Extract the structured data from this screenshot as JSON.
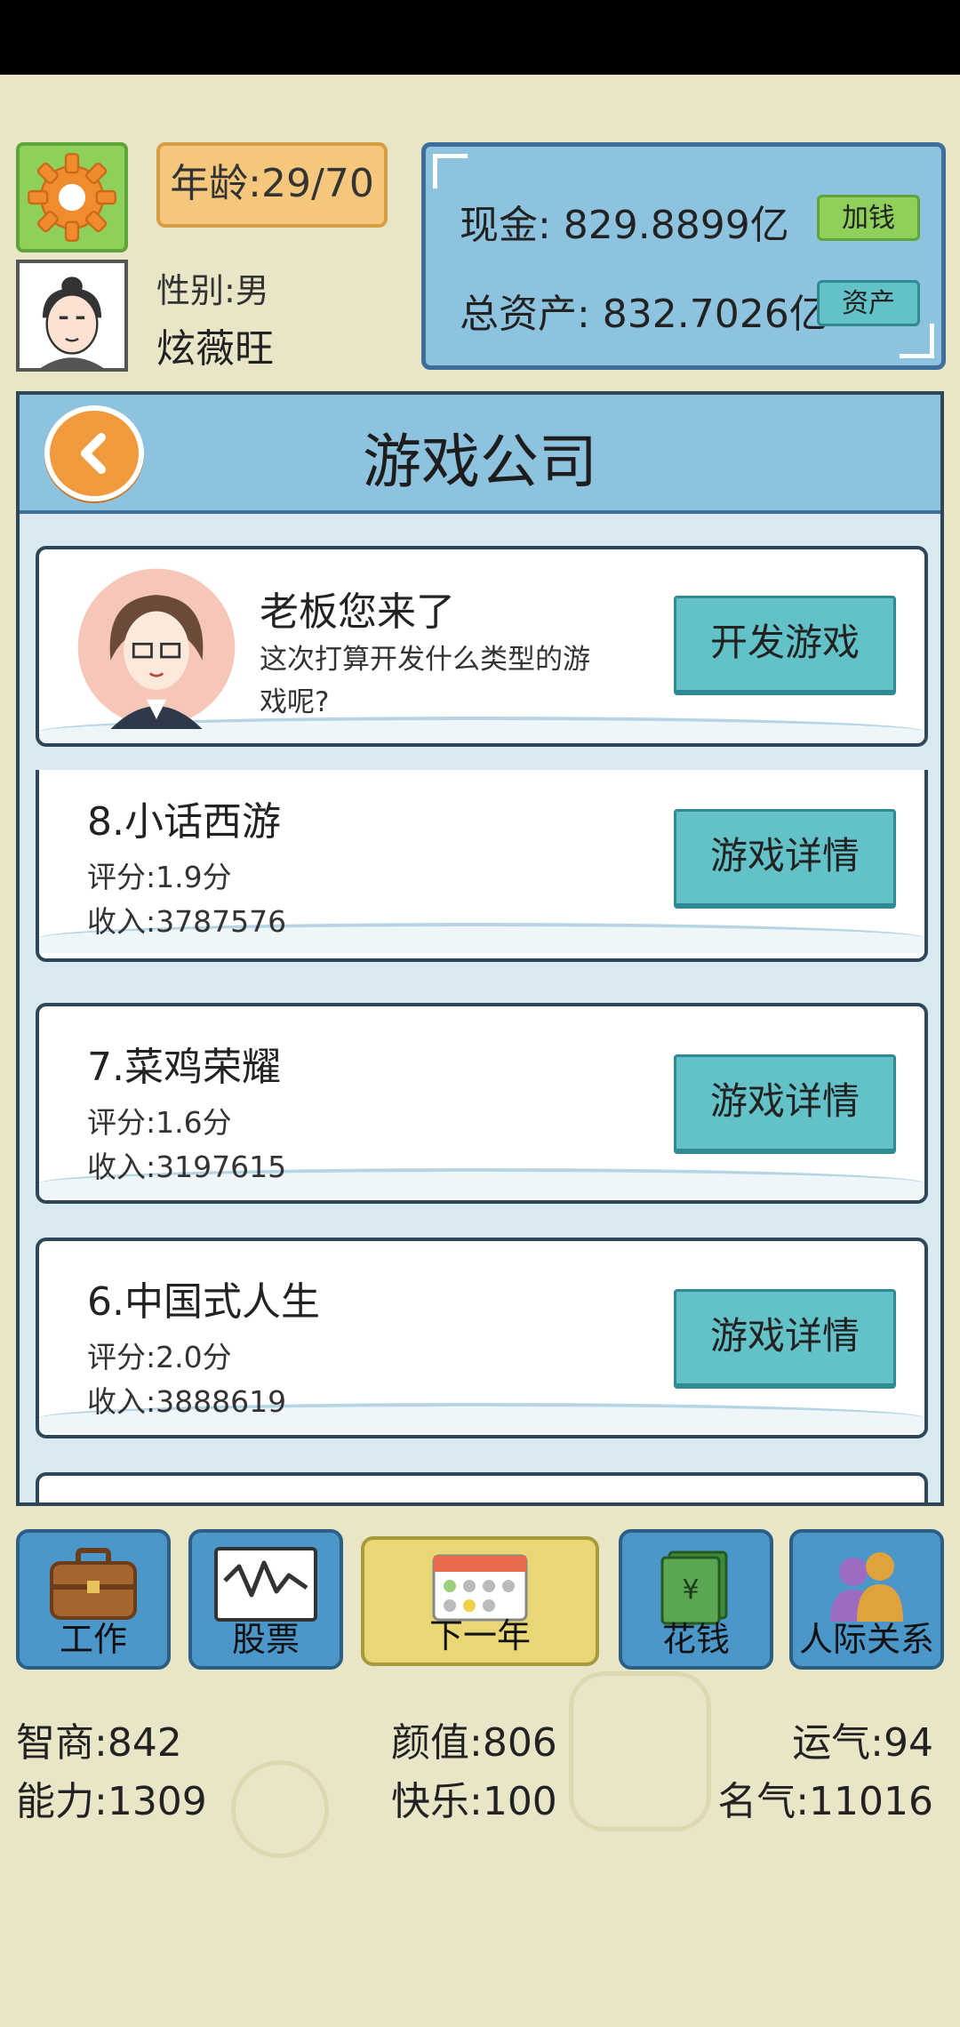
{
  "header": {
    "age": "年龄:29/70",
    "gender": "性别:男",
    "name": "炫薇旺",
    "cash": "现金: 829.8899亿",
    "assets": "总资产: 832.7026亿",
    "add_money_label": "加钱",
    "assets_button_label": "资产"
  },
  "panel": {
    "title": "游戏公司",
    "intro": {
      "greeting": "老板您来了",
      "question": "这次打算开发什么类型的游戏呢?",
      "button": "开发游戏"
    },
    "games": [
      {
        "name": "8.小话西游",
        "score": "评分:1.9分",
        "income": "收入:3787576",
        "button": "游戏详情"
      },
      {
        "name": "7.菜鸡荣耀",
        "score": "评分:1.6分",
        "income": "收入:3197615",
        "button": "游戏详情"
      },
      {
        "name": "6.中国式人生",
        "score": "评分:2.0分",
        "income": "收入:3888619",
        "button": "游戏详情"
      }
    ]
  },
  "nav": [
    {
      "label": "工作",
      "icon": "briefcase-icon"
    },
    {
      "label": "股票",
      "icon": "stock-chart-icon"
    },
    {
      "label": "下一年",
      "icon": "calendar-icon"
    },
    {
      "label": "花钱",
      "icon": "money-icon"
    },
    {
      "label": "人际关系",
      "icon": "people-icon"
    }
  ],
  "stats": {
    "iq": "智商:842",
    "looks": "颜值:806",
    "luck": "运气:94",
    "ability": "能力:1309",
    "happiness": "快乐:100",
    "fame": "名气:11016"
  },
  "colors": {
    "background": "#e9e6c8",
    "panel_blue": "#8ec3df",
    "button_teal": "#62c2c8",
    "nav_blue": "#4b97c9",
    "next_year_yellow": "#e8d774",
    "green": "#8ed05a",
    "orange": "#f09a3e"
  }
}
